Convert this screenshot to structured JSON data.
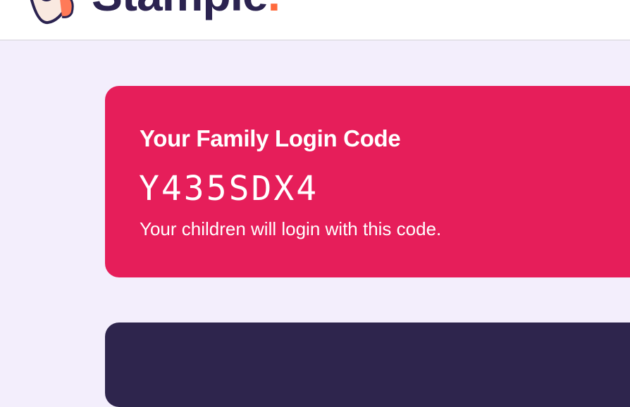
{
  "header": {
    "logo_text": "Stample",
    "logo_dot": ".",
    "logo_icon": "stamp-mascot-icon"
  },
  "login_code_card": {
    "title": "Your Family Login Code",
    "code": "Y435SDX4",
    "note": "Your children will login with this code."
  },
  "colors": {
    "page_background": "#f3eefc",
    "header_background": "#ffffff",
    "code_card_background": "#e61e5a",
    "next_card_background": "#2e254d",
    "logo_text": "#2b2350",
    "logo_dot": "#ff6a3d"
  }
}
